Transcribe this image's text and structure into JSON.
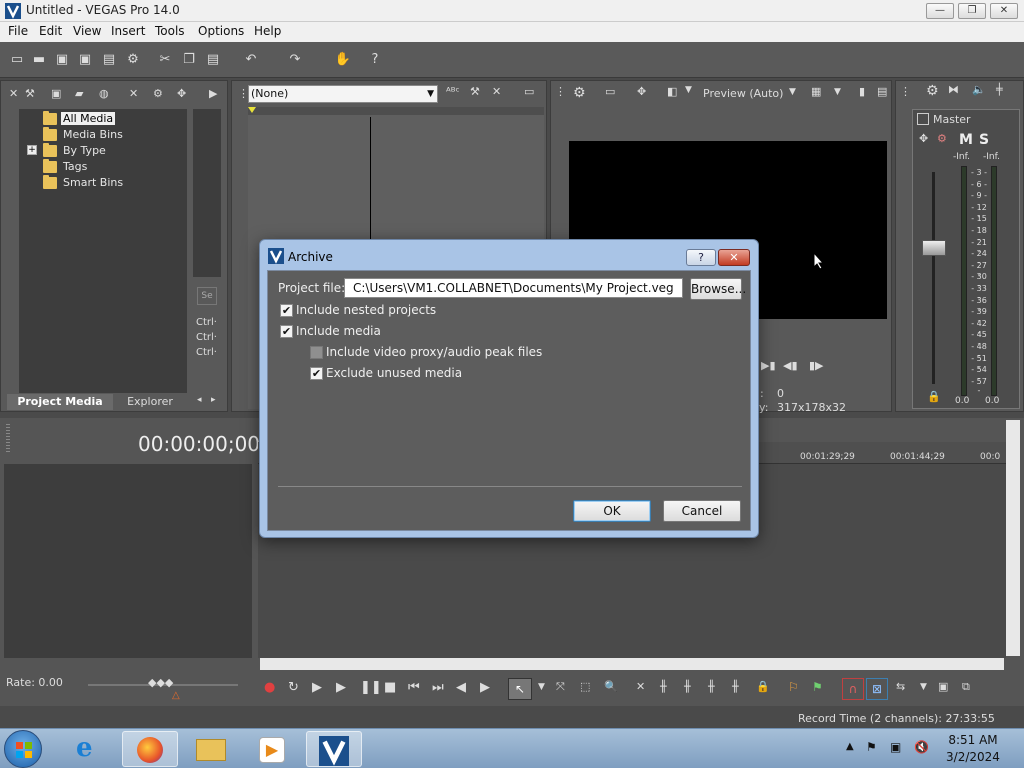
{
  "window": {
    "title": "Untitled - VEGAS Pro 14.0",
    "minimize": "—",
    "maximize": "❐",
    "close": "✕"
  },
  "menu": [
    "File",
    "Edit",
    "View",
    "Insert",
    "Tools",
    "Options",
    "Help"
  ],
  "media_tree": {
    "items": [
      "All Media",
      "Media Bins",
      "By Type",
      "Tags",
      "Smart Bins"
    ],
    "expander": "+"
  },
  "explorer_side": {
    "s_label": "Se",
    "ctrl_labels": [
      "Ctrl·",
      "Ctrl·",
      "Ctrl·"
    ]
  },
  "tabs": {
    "project_media": "Project Media",
    "explorer": "Explorer"
  },
  "trimmer": {
    "dropdown_value": "(None)"
  },
  "preview": {
    "mode": "Preview (Auto)",
    "frame_value": "0",
    "display_value": "317x178x32",
    "display_prefix": "y:"
  },
  "mixer": {
    "master_label": "Master",
    "m_label": "M",
    "s_label": "S",
    "inf_left": "-Inf.",
    "inf_right": "-Inf.",
    "scale": [
      "3",
      "6",
      "9",
      "12",
      "15",
      "18",
      "21",
      "24",
      "27",
      "30",
      "33",
      "36",
      "39",
      "42",
      "45",
      "48",
      "51",
      "54",
      "57"
    ],
    "bottom_left": "0.0",
    "bottom_right": "0.0"
  },
  "timeline": {
    "timecode": "00:00:00;00",
    "ruler": [
      "00:01:29;29",
      "00:01:44;29",
      "00:0"
    ],
    "rate_label": "Rate: 0.00",
    "record_time": "Record Time (2 channels): 27:33:55"
  },
  "dialog": {
    "title": "Archive",
    "help_btn": "?",
    "close_btn": "✕",
    "project_file_label": "Project file:",
    "project_file_value": "C:\\Users\\VM1.COLLABNET\\Documents\\My Project.veg",
    "browse_label": "Browse...",
    "include_nested": "Include nested projects",
    "include_media": "Include media",
    "include_proxy": "Include video proxy/audio peak files",
    "exclude_unused": "Exclude unused media",
    "ok_label": "OK",
    "cancel_label": "Cancel"
  },
  "taskbar": {
    "time": "8:51 AM",
    "date": "3/2/2024"
  }
}
